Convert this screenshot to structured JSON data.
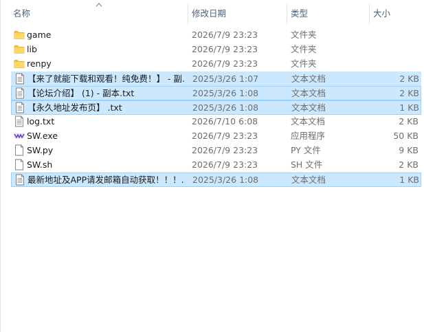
{
  "columns": {
    "name": "名称",
    "date": "修改日期",
    "type": "类型",
    "size": "大小"
  },
  "files": [
    {
      "name": "game",
      "date": "2026/7/9 23:23",
      "type": "文件夹",
      "size": "",
      "icon": "folder-icon",
      "selected": false
    },
    {
      "name": "lib",
      "date": "2026/7/9 23:23",
      "type": "文件夹",
      "size": "",
      "icon": "folder-icon",
      "selected": false
    },
    {
      "name": "renpy",
      "date": "2026/7/9 23:23",
      "type": "文件夹",
      "size": "",
      "icon": "folder-icon",
      "selected": false
    },
    {
      "name": "【来了就能下载和观看！纯免费！】 - 副...",
      "date": "2025/3/26 1:07",
      "type": "文本文档",
      "size": "2 KB",
      "icon": "text-file-icon",
      "selected": true
    },
    {
      "name": "【论坛介绍】 (1) - 副本.txt",
      "date": "2025/3/26 1:08",
      "type": "文本文档",
      "size": "2 KB",
      "icon": "text-file-icon",
      "selected": true
    },
    {
      "name": "【永久地址发布页】 .txt",
      "date": "2025/3/26 1:08",
      "type": "文本文档",
      "size": "1 KB",
      "icon": "text-file-icon",
      "selected": true
    },
    {
      "name": "log.txt",
      "date": "2026/7/10 6:08",
      "type": "文本文档",
      "size": "2 KB",
      "icon": "text-file-icon",
      "selected": false
    },
    {
      "name": "SW.exe",
      "date": "2026/7/9 23:23",
      "type": "应用程序",
      "size": "50 KB",
      "icon": "renpy-app-icon",
      "selected": false
    },
    {
      "name": "SW.py",
      "date": "2026/7/9 23:23",
      "type": "PY 文件",
      "size": "9 KB",
      "icon": "file-icon",
      "selected": false
    },
    {
      "name": "SW.sh",
      "date": "2026/7/9 23:23",
      "type": "SH 文件",
      "size": "2 KB",
      "icon": "file-icon",
      "selected": false
    },
    {
      "name": "最新地址及APP请发邮箱自动获取！！！...",
      "date": "2025/3/26 1:08",
      "type": "文本文档",
      "size": "1 KB",
      "icon": "text-file-icon",
      "selected": true
    }
  ]
}
